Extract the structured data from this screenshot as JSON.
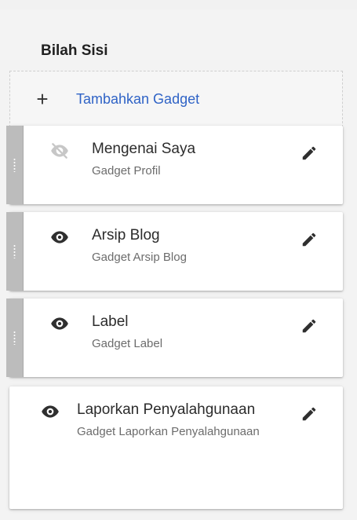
{
  "sidebar": {
    "title": "Bilah Sisi",
    "add_gadget_label": "Tambahkan Gadget",
    "gadgets": [
      {
        "name": "Mengenai Saya",
        "subtitle": "Gadget Profil",
        "visibility_icon": "eye-off-icon",
        "edit_icon": "pencil-icon"
      },
      {
        "name": "Arsip Blog",
        "subtitle": "Gadget Arsip Blog",
        "visibility_icon": "eye-icon",
        "edit_icon": "pencil-icon"
      },
      {
        "name": "Label",
        "subtitle": "Gadget Label",
        "visibility_icon": "eye-icon",
        "edit_icon": "pencil-icon"
      },
      {
        "name": "Laporkan Penyalahgunaan",
        "subtitle": "Gadget Laporkan Penyalahgunaan",
        "visibility_icon": "eye-icon",
        "edit_icon": "pencil-icon"
      }
    ]
  },
  "colors": {
    "link_blue": "#2f63c6",
    "text_dark": "#2c2c2c",
    "text_muted": "#6c6c6c",
    "handle_gray": "#bcbcbc"
  }
}
